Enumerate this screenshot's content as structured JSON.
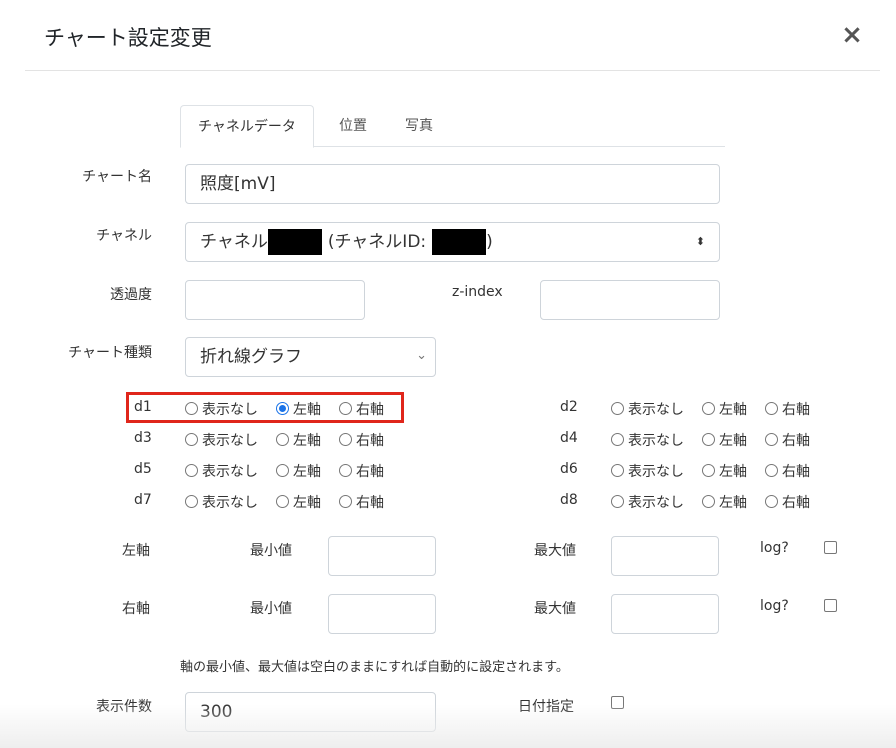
{
  "modal": {
    "title": "チャート設定変更",
    "close_glyph": "×"
  },
  "tabs": [
    {
      "label": "チャネルデータ",
      "active": true
    },
    {
      "label": "位置",
      "active": false
    },
    {
      "label": "写真",
      "active": false
    }
  ],
  "chart_name": {
    "label": "チャート名",
    "value": "照度[mV]"
  },
  "channel": {
    "label": "チャネル",
    "prefix": "チャネル",
    "middle": "(チャネルID:",
    "suffix": ")",
    "arrow": "⬍"
  },
  "opacity": {
    "label": "透過度",
    "value": ""
  },
  "zindex": {
    "label": "z-index",
    "value": ""
  },
  "chart_type": {
    "label": "チャート種類",
    "value": "折れ線グラフ",
    "chevron": "⌄"
  },
  "series": [
    {
      "name": "d1",
      "options": [
        "表示なし",
        "左軸",
        "右軸"
      ],
      "selected": "左軸"
    },
    {
      "name": "d2",
      "options": [
        "表示なし",
        "左軸",
        "右軸"
      ],
      "selected": ""
    },
    {
      "name": "d3",
      "options": [
        "表示なし",
        "左軸",
        "右軸"
      ],
      "selected": ""
    },
    {
      "name": "d4",
      "options": [
        "表示なし",
        "左軸",
        "右軸"
      ],
      "selected": ""
    },
    {
      "name": "d5",
      "options": [
        "表示なし",
        "左軸",
        "右軸"
      ],
      "selected": ""
    },
    {
      "name": "d6",
      "options": [
        "表示なし",
        "左軸",
        "右軸"
      ],
      "selected": ""
    },
    {
      "name": "d7",
      "options": [
        "表示なし",
        "左軸",
        "右軸"
      ],
      "selected": ""
    },
    {
      "name": "d8",
      "options": [
        "表示なし",
        "左軸",
        "右軸"
      ],
      "selected": ""
    }
  ],
  "axes": [
    {
      "label": "左軸",
      "min_label": "最小値",
      "min_value": "",
      "max_label": "最大値",
      "max_value": "",
      "log_label": "log?",
      "log_checked": false
    },
    {
      "label": "右軸",
      "min_label": "最小値",
      "min_value": "",
      "max_label": "最大値",
      "max_value": "",
      "log_label": "log?",
      "log_checked": false
    }
  ],
  "axis_note": "軸の最小値、最大値は空白のままにすれば自動的に設定されます。",
  "display_count": {
    "label": "表示件数",
    "value": "300"
  },
  "date_spec": {
    "label": "日付指定",
    "checked": false
  },
  "colors": {
    "accent": "#1a73e8",
    "highlight": "#e0261b"
  }
}
